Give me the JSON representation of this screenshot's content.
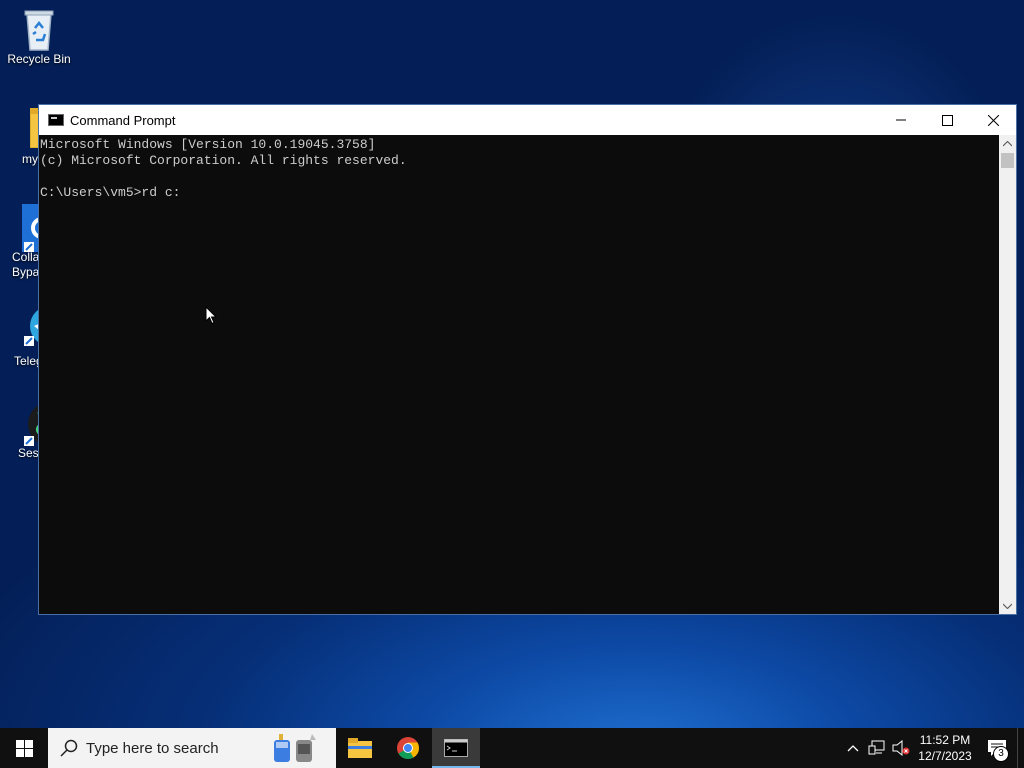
{
  "desktop": {
    "icons": [
      {
        "label": "Recycle Bin",
        "icon": "recycle-bin-icon"
      },
      {
        "label": "my",
        "icon": "folder-icon"
      },
      {
        "label": "Colla\nBypa",
        "icon": "settings-app-icon"
      },
      {
        "label": "Teleg",
        "icon": "telegram-icon"
      },
      {
        "label": "Sess",
        "icon": "session-icon"
      }
    ]
  },
  "window": {
    "title": "Command Prompt",
    "console_lines": [
      "Microsoft Windows [Version 10.0.19045.3758]",
      "(c) Microsoft Corporation. All rights reserved.",
      "",
      "C:\\Users\\vm5>rd c:"
    ]
  },
  "taskbar": {
    "search_placeholder": "Type here to search",
    "apps": [
      "file-explorer-icon",
      "chrome-icon",
      "command-prompt-icon"
    ],
    "time": "11:52 PM",
    "date": "12/7/2023",
    "notification_count": "3"
  }
}
